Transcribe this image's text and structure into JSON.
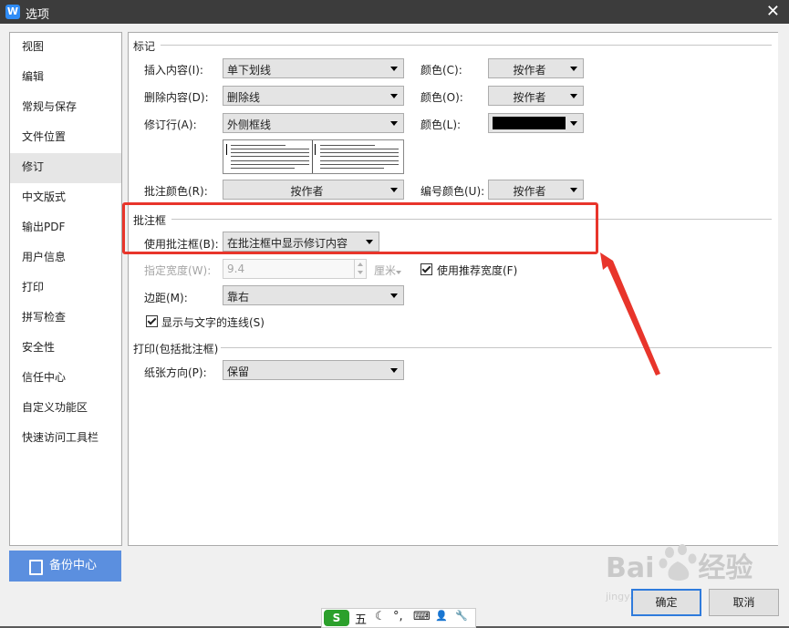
{
  "window": {
    "title": "选项",
    "logo_letter": "W"
  },
  "sidebar": {
    "items": [
      {
        "label": "视图"
      },
      {
        "label": "编辑"
      },
      {
        "label": "常规与保存"
      },
      {
        "label": "文件位置"
      },
      {
        "label": "修订",
        "active": true
      },
      {
        "label": "中文版式"
      },
      {
        "label": "输出PDF"
      },
      {
        "label": "用户信息"
      },
      {
        "label": "打印"
      },
      {
        "label": "拼写检查"
      },
      {
        "label": "安全性"
      },
      {
        "label": "信任中心"
      },
      {
        "label": "自定义功能区"
      },
      {
        "label": "快速访问工具栏"
      }
    ],
    "backup_label": "备份中心"
  },
  "marks": {
    "title": "标记",
    "insert_label": "插入内容(I):",
    "insert_value": "单下划线",
    "insert_color_label": "颜色(C):",
    "insert_color_value": "按作者",
    "delete_label": "删除内容(D):",
    "delete_value": "删除线",
    "delete_color_label": "颜色(O):",
    "delete_color_value": "按作者",
    "changed_line_label": "修订行(A):",
    "changed_line_value": "外侧框线",
    "changed_line_color_label": "颜色(L):",
    "changed_line_color_hex": "#000000",
    "comment_color_label": "批注颜色(R):",
    "comment_color_value": "按作者",
    "number_color_label": "编号颜色(U):",
    "number_color_value": "按作者"
  },
  "balloons": {
    "title": "批注框",
    "use_label": "使用批注框(B):",
    "use_value": "在批注框中显示修订内容",
    "width_label": "指定宽度(W):",
    "width_value": "9.4",
    "width_unit": "厘米",
    "recommended_width_label": "使用推荐宽度(F)",
    "recommended_width_checked": true,
    "margin_label": "边距(M):",
    "margin_value": "靠右",
    "show_lines_label": "显示与文字的连线(S)",
    "show_lines_checked": true
  },
  "printing": {
    "title": "打印(包括批注框)",
    "orientation_label": "纸张方向(P):",
    "orientation_value": "保留"
  },
  "buttons": {
    "ok": "确定",
    "cancel": "取消"
  },
  "ime": {
    "logo": "S",
    "mode": "五",
    "items": [
      "☾",
      "°,",
      "⌨",
      "👤",
      "🔧"
    ]
  },
  "watermark": {
    "brand": "Bai",
    "brand_suffix": "经验",
    "url": "jingyan.baidu.com"
  },
  "colors": {
    "accent": "#5b8fdf",
    "highlight": "#e8352b",
    "titlebar": "#3c3c3c"
  }
}
